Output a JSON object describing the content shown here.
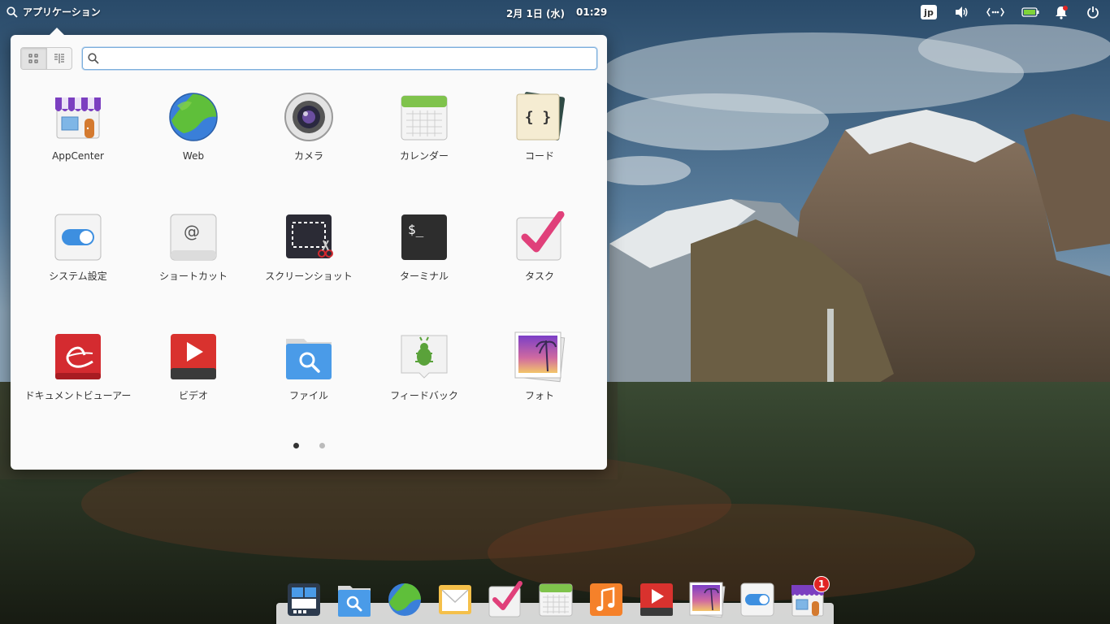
{
  "panel": {
    "applications_label": "アプリケーション",
    "date": "2月 1日 (水)",
    "time": "01:29",
    "keyboard_layout": "jp",
    "indicators": [
      "volume-icon",
      "network-icon",
      "battery-icon",
      "notification-icon",
      "power-icon"
    ]
  },
  "launcher": {
    "search_value": "",
    "view_modes": [
      "grid-view",
      "category-view"
    ],
    "apps": [
      {
        "label": "AppCenter",
        "icon": "appcenter-icon"
      },
      {
        "label": "Web",
        "icon": "web-browser-icon"
      },
      {
        "label": "カメラ",
        "icon": "camera-icon"
      },
      {
        "label": "カレンダー",
        "icon": "calendar-icon"
      },
      {
        "label": "コード",
        "icon": "code-icon"
      },
      {
        "label": "システム設定",
        "icon": "system-settings-icon"
      },
      {
        "label": "ショートカット",
        "icon": "shortcut-icon"
      },
      {
        "label": "スクリーンショット",
        "icon": "screenshot-icon"
      },
      {
        "label": "ターミナル",
        "icon": "terminal-icon"
      },
      {
        "label": "タスク",
        "icon": "tasks-icon"
      },
      {
        "label": "ドキュメントビューアー",
        "icon": "document-viewer-icon"
      },
      {
        "label": "ビデオ",
        "icon": "videos-icon"
      },
      {
        "label": "ファイル",
        "icon": "files-icon"
      },
      {
        "label": "フィードバック",
        "icon": "feedback-icon"
      },
      {
        "label": "フォト",
        "icon": "photos-icon"
      }
    ],
    "pages": 2,
    "current_page": 1
  },
  "dock": {
    "items": [
      {
        "icon": "multitasking-view-icon"
      },
      {
        "icon": "files-icon"
      },
      {
        "icon": "web-browser-icon"
      },
      {
        "icon": "mail-icon"
      },
      {
        "icon": "tasks-icon"
      },
      {
        "icon": "calendar-icon"
      },
      {
        "icon": "music-icon"
      },
      {
        "icon": "videos-icon"
      },
      {
        "icon": "photos-icon"
      },
      {
        "icon": "system-settings-icon"
      },
      {
        "icon": "appcenter-icon",
        "badge": "1"
      }
    ]
  }
}
